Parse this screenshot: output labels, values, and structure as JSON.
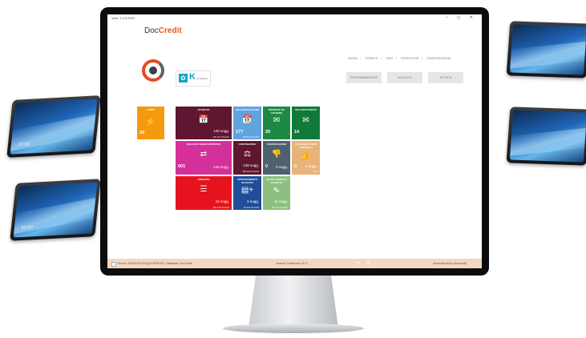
{
  "window": {
    "title": "Vers. 1.0.0.2022",
    "controls": "– ◻ ✕"
  },
  "app": {
    "name_prefix": "Doc",
    "name_accent": "Credit"
  },
  "partner_logo": {
    "letter": "K",
    "tagline": "consulting"
  },
  "nav": {
    "items": [
      "AZIONI",
      "STORICO",
      "FIDO",
      "STATISTICHE",
      "CONFIGURAZIONI"
    ],
    "separator": "/"
  },
  "buttons": {
    "b1": "PROGRAMMAZIONE",
    "b2": "SOLLECITI",
    "b3": "ATTIVITÀ"
  },
  "tiles": {
    "lampo": {
      "label": "LAMPO",
      "count": "29",
      "icon": "⚡",
      "color": "#f59a0e"
    },
    "scaduto": {
      "label": "SCADUTO",
      "icon": "📅",
      "sogg": "125 sogg.",
      "eur": "145.167,00 EUR",
      "color": "#5e1631"
    },
    "sollecitiDaFare": {
      "label": "SOLLECITI DA FARE",
      "count": "177",
      "icon": "📆",
      "eur": "136.517,00 EUR",
      "color": "#5fa3e0"
    },
    "rispostaLeggere": {
      "label": "RISPOSTE DA LEGGERE",
      "count": "29",
      "icon": "✉",
      "color": "#1e8845"
    },
    "sollecitiInviati": {
      "label": "SOLLECITI INVIATI",
      "count": "14",
      "icon": "✉",
      "color": "#117a3b"
    },
    "sollecitiSenzaRisposta": {
      "label": "SOLLECITI SENZA RISPOSTA",
      "count": "601",
      "icon": "⇄",
      "sogg": "125 sogg.",
      "color": "#d5309a"
    },
    "contenzioso": {
      "label": "CONTENZIOSO",
      "icon": "⚖",
      "sogg": "138 sogg.",
      "eur": "256.261,00 EUR",
      "color": "#5e1631"
    },
    "contestazioni": {
      "label": "CONTESTAZIONI",
      "count": "0",
      "icon": "👎",
      "sogg": "0 sogg.",
      "color": "#4f616e"
    },
    "casiRisolti": {
      "label": "CASI RISOLTI NON CONTABILI",
      "count": "0",
      "icon": "👍",
      "sogg": "0 sogg.",
      "eur": "0,00",
      "color": "#e8b37a"
    },
    "urgente": {
      "label": "URGENTE",
      "icon": "☰",
      "sogg": "15 sogg.",
      "eur": "120.415,00 EUR",
      "color": "#e6131f"
    },
    "appuntamento": {
      "label": "APPUNTAMENTO SCADUTO",
      "icon": "▤+",
      "sogg": "5 sogg.",
      "eur": "53.651,00 EUR",
      "color": "#1f4d9a"
    },
    "saldoParziale": {
      "label": "SALDO PARZIALE SCADUTO",
      "icon": "✎",
      "sogg": "11 sogg.",
      "eur": "176.470,00 EUR",
      "color": "#8cc07e"
    }
  },
  "status": {
    "server": "Server: GESDOOLIT\\SQLEXPRESS | Database: DocCredit",
    "datetime": "venerdì 24 febbraio 14:17",
    "user": "doccredit admin (doccredit)"
  }
}
